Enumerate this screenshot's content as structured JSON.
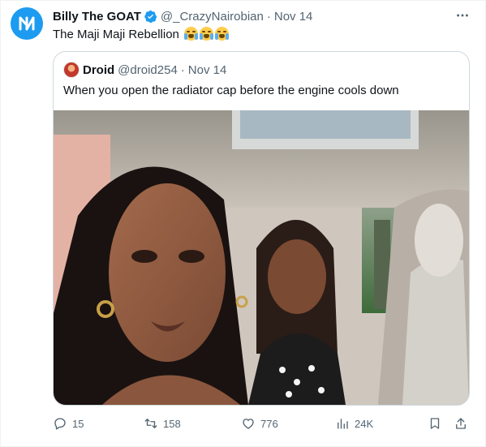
{
  "tweet": {
    "author": {
      "display_name": "Billy The GOAT",
      "handle": "@_CrazyNairobian",
      "separator": "·",
      "date": "Nov 14",
      "avatar_icon": "logo-icon",
      "verified_icon": "verified-badge-icon"
    },
    "text": "The Maji Maji Rebellion",
    "emojis": [
      "loudly-crying-face-emoji",
      "loudly-crying-face-emoji",
      "loudly-crying-face-emoji"
    ],
    "more_icon": "more-options-icon"
  },
  "quoted": {
    "display_name": "Droid",
    "handle": "@droid254",
    "separator": "·",
    "date": "Nov 14",
    "text": "When you open the radiator cap before the engine cools down",
    "media_alt": "selfie in car"
  },
  "actions": {
    "reply": {
      "icon": "reply-icon",
      "count": "15"
    },
    "retweet": {
      "icon": "retweet-icon",
      "count": "158"
    },
    "like": {
      "icon": "heart-icon",
      "count": "776"
    },
    "views": {
      "icon": "views-icon",
      "count": "24K"
    },
    "bookmark": {
      "icon": "bookmark-icon"
    },
    "share": {
      "icon": "share-icon"
    }
  },
  "colors": {
    "accent": "#1d9bf0",
    "text_primary": "#0f1419",
    "text_secondary": "#536471",
    "border": "#cfd9de"
  }
}
